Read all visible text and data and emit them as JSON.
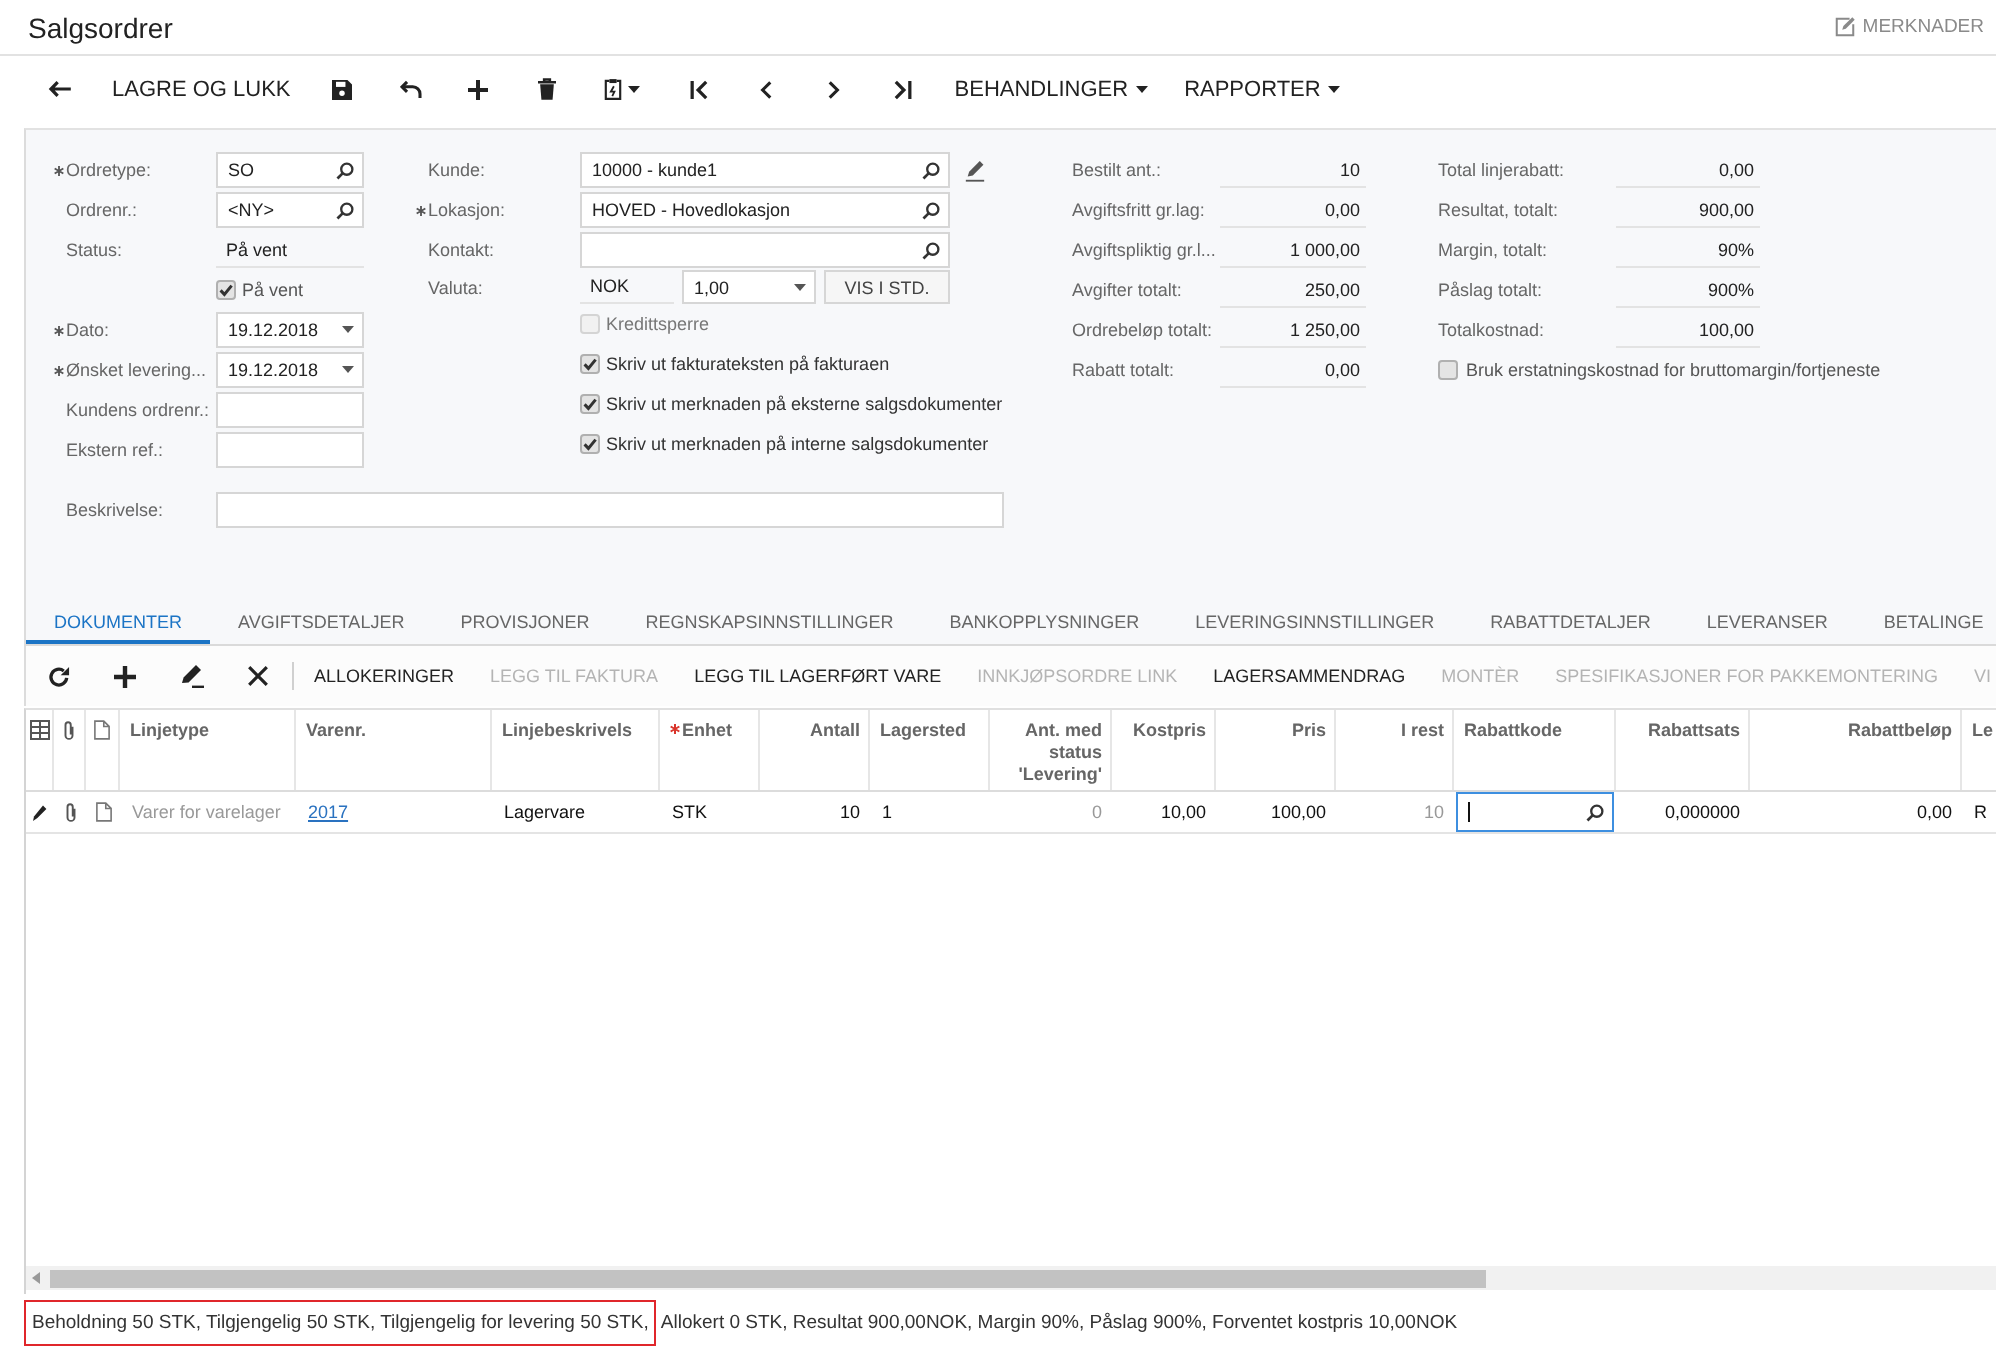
{
  "header": {
    "title": "Salgsordrer",
    "notes_button": "MERKNADER"
  },
  "toolbar": {
    "save_close": "LAGRE OG LUKK",
    "menus": [
      "BEHANDLINGER",
      "RAPPORTER"
    ]
  },
  "form": {
    "left": [
      {
        "kind": "lookup",
        "label": "Ordretype:",
        "required": true,
        "value": "SO"
      },
      {
        "kind": "lookup",
        "label": "Ordrenr.:",
        "required": false,
        "value": "<NY>"
      },
      {
        "kind": "readonly",
        "label": "Status:",
        "required": false,
        "value": "På vent"
      },
      {
        "kind": "checkbox",
        "label": "På vent",
        "checked": true,
        "disabled": false
      },
      {
        "kind": "date",
        "label": "Dato:",
        "required": true,
        "value": "19.12.2018"
      },
      {
        "kind": "date",
        "label": "Ønsket levering...",
        "required": true,
        "value": "19.12.2018"
      },
      {
        "kind": "input",
        "label": "Kundens ordrenr.:",
        "required": false
      },
      {
        "kind": "input",
        "label": "Ekstern ref.:",
        "required": false
      }
    ],
    "middle": [
      {
        "kind": "lookup",
        "label": "Kunde:",
        "required": false,
        "value": "10000 - kunde1",
        "edit_button": true
      },
      {
        "kind": "lookup",
        "label": "Lokasjon:",
        "required": true,
        "value": "HOVED - Hovedlokasjon",
        "edit_button": false
      },
      {
        "kind": "lookup",
        "label": "Kontakt:",
        "required": false,
        "edit_button": false
      },
      {
        "kind": "currency",
        "label": "Valuta:",
        "required": false,
        "value": "NOK",
        "rate": "1,00",
        "button": "VIS I STD."
      },
      {
        "kind": "checkbox",
        "label": "Kredittsperre",
        "checked": false,
        "disabled": true
      },
      {
        "kind": "checkbox",
        "label": "Skriv ut fakturateksten på fakturaen",
        "checked": true,
        "disabled": false
      },
      {
        "kind": "checkbox",
        "label": "Skriv ut merknaden på eksterne salgsdokumenter",
        "checked": true,
        "disabled": false
      },
      {
        "kind": "checkbox",
        "label": "Skriv ut merknaden på interne salgsdokumenter",
        "checked": true,
        "disabled": false
      }
    ],
    "totals": [
      {
        "label": "Bestilt ant.:",
        "value": "10"
      },
      {
        "label": "Avgiftsfritt gr.lag:",
        "value": "0,00"
      },
      {
        "label": "Avgiftspliktig gr.l...",
        "value": "1 000,00"
      },
      {
        "label": "Avgifter totalt:",
        "value": "250,00"
      },
      {
        "label": "Ordrebeløp totalt:",
        "value": "1 250,00"
      },
      {
        "label": "Rabatt totalt:",
        "value": "0,00"
      }
    ],
    "totals_2": [
      {
        "label": "Total linjerabatt:",
        "value": "0,00"
      },
      {
        "label": "Resultat, totalt:",
        "value": "900,00"
      },
      {
        "label": "Margin, totalt:",
        "value": "90%"
      },
      {
        "label": "Påslag totalt:",
        "value": "900%"
      },
      {
        "label": "Totalkostnad:",
        "value": "100,00"
      }
    ],
    "replacement_cost": {
      "label": "Bruk erstatningskostnad for bruttomargin/fortjeneste",
      "checked": false
    },
    "description": {
      "label": "Beskrivelse:"
    }
  },
  "tabs": [
    {
      "label": "DOKUMENTER",
      "selected": true
    },
    {
      "label": "AVGIFTSDETALJER",
      "selected": false
    },
    {
      "label": "PROVISJONER",
      "selected": false
    },
    {
      "label": "REGNSKAPSINNSTILLINGER",
      "selected": false
    },
    {
      "label": "BANKOPPLYSNINGER",
      "selected": false
    },
    {
      "label": "LEVERINGSINNSTILLINGER",
      "selected": false
    },
    {
      "label": "RABATTDETALJER",
      "selected": false
    },
    {
      "label": "LEVERANSER",
      "selected": false
    },
    {
      "label": "BETALINGE",
      "selected": false
    }
  ],
  "grid_toolbar": {
    "actions": [
      {
        "label": "ALLOKERINGER",
        "disabled": false
      },
      {
        "label": "LEGG TIL FAKTURA",
        "disabled": true
      },
      {
        "label": "LEGG TIL LAGERFØRT VARE",
        "disabled": false
      },
      {
        "label": "INNKJØPSORDRE LINK",
        "disabled": true
      },
      {
        "label": "LAGERSAMMENDRAG",
        "disabled": false
      },
      {
        "label": "MONTÈR",
        "disabled": true
      },
      {
        "label": "SPESIFIKASJONER FOR PAKKEMONTERING",
        "disabled": true
      },
      {
        "label": "VI",
        "disabled": true
      }
    ]
  },
  "grid": {
    "columns": [
      {
        "label": "Linjetype",
        "required": false
      },
      {
        "label": "Varenr.",
        "required": false
      },
      {
        "label": "Linjebeskrivels",
        "required": false
      },
      {
        "label": "Enhet",
        "required": true
      },
      {
        "label": "Antall",
        "required": false
      },
      {
        "label": "Lagersted",
        "required": false
      },
      {
        "label": "Ant. med\nstatus\n'Levering'",
        "required": false
      },
      {
        "label": "Kostpris",
        "required": false
      },
      {
        "label": "Pris",
        "required": false
      },
      {
        "label": "I rest",
        "required": false
      },
      {
        "label": "Rabattkode",
        "required": false
      },
      {
        "label": "Rabattsats",
        "required": false
      },
      {
        "label": "Rabattbeløp",
        "required": false
      },
      {
        "label": "Le",
        "required": false
      }
    ],
    "rows": [
      {
        "cells": [
          {
            "kind": "muted",
            "text": "Varer for varelager"
          },
          {
            "kind": "link",
            "text": "2017"
          },
          {
            "kind": "text",
            "text": "Lagervare"
          },
          {
            "kind": "text",
            "text": "STK"
          },
          {
            "kind": "text",
            "text": "10"
          },
          {
            "kind": "text",
            "text": "1"
          },
          {
            "kind": "muted",
            "text": "0"
          },
          {
            "kind": "text",
            "text": "10,00"
          },
          {
            "kind": "text",
            "text": "100,00"
          },
          {
            "kind": "muted",
            "text": "10"
          },
          {
            "kind": "lookup",
            "focused": true
          },
          {
            "kind": "text",
            "text": "0,000000"
          },
          {
            "kind": "text",
            "text": "0,00"
          },
          {
            "kind": "text",
            "text": "R"
          }
        ]
      }
    ]
  },
  "status_bar": {
    "segments": [
      {
        "text": "Beholdning 50 STK, Tilgjengelig 50 STK, Tilgjengelig for levering 50 STK,",
        "highlighted": true
      },
      {
        "text": "Allokert 0 STK, Resultat 900,00NOK, Margin 90%, Påslag 900%, Forventet kostpris 10,00NOK",
        "highlighted": false
      }
    ]
  }
}
